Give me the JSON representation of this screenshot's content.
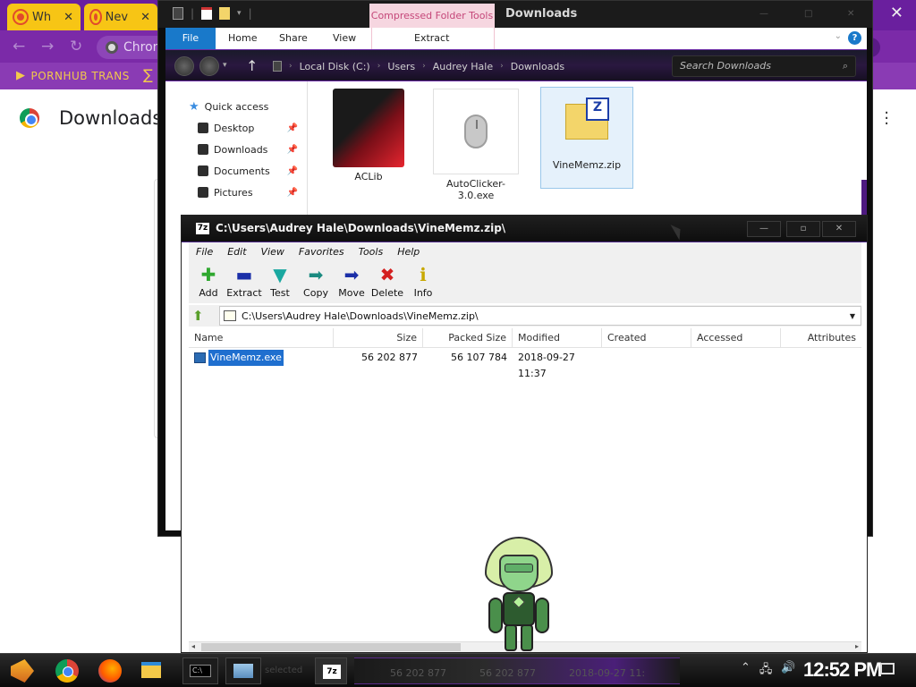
{
  "chrome": {
    "tabs": [
      {
        "label": "Wh"
      },
      {
        "label": "Nev"
      }
    ],
    "omnibox_text": "Chron",
    "bookmark_label": "PORNHUB TRANS",
    "page_title": "Downloads"
  },
  "explorer": {
    "context_tab": "Compressed Folder Tools",
    "window_title": "Downloads",
    "ribbon_tabs": [
      "File",
      "Home",
      "Share",
      "View"
    ],
    "ribbon_context_tab": "Extract",
    "path": [
      "Local Disk (C:)",
      "Users",
      "Audrey Hale",
      "Downloads"
    ],
    "search_placeholder": "Search Downloads",
    "nav": {
      "quick_access": "Quick access",
      "items": [
        {
          "label": "Desktop"
        },
        {
          "label": "Downloads"
        },
        {
          "label": "Documents"
        },
        {
          "label": "Pictures"
        }
      ]
    },
    "files": [
      {
        "name": "ACLib"
      },
      {
        "name": "AutoClicker-3.0.exe"
      },
      {
        "name": "VineMemz.zip"
      }
    ]
  },
  "zip": {
    "title": "C:\\Users\\Audrey Hale\\Downloads\\VineMemz.zip\\",
    "icon_label": "7z",
    "menu": [
      "File",
      "Edit",
      "View",
      "Favorites",
      "Tools",
      "Help"
    ],
    "toolbar": [
      {
        "label": "Add",
        "glyph": "✚",
        "color": "#2fa82f"
      },
      {
        "label": "Extract",
        "glyph": "▬",
        "color": "#1b2fa8"
      },
      {
        "label": "Test",
        "glyph": "▼",
        "color": "#1aa8a0"
      },
      {
        "label": "Copy",
        "glyph": "➡",
        "color": "#1a8a80"
      },
      {
        "label": "Move",
        "glyph": "➡",
        "color": "#1b2fa8"
      },
      {
        "label": "Delete",
        "glyph": "✖",
        "color": "#d42020"
      },
      {
        "label": "Info",
        "glyph": "ℹ",
        "color": "#c8a800"
      }
    ],
    "address": "C:\\Users\\Audrey Hale\\Downloads\\VineMemz.zip\\",
    "columns": [
      "Name",
      "Size",
      "Packed Size",
      "Modified",
      "Created",
      "Accessed",
      "Attributes"
    ],
    "rows": [
      {
        "name": "VineMemz.exe",
        "size": "56 202 877",
        "packed": "56 107 784",
        "modified": "2018-09-27 11:37"
      }
    ]
  },
  "taskbar": {
    "clock": "12:52 PM",
    "ghost_text": [
      "56 202 877",
      "56 202 877",
      "2018-09-27 11:"
    ],
    "ghost_selected": "selected"
  }
}
